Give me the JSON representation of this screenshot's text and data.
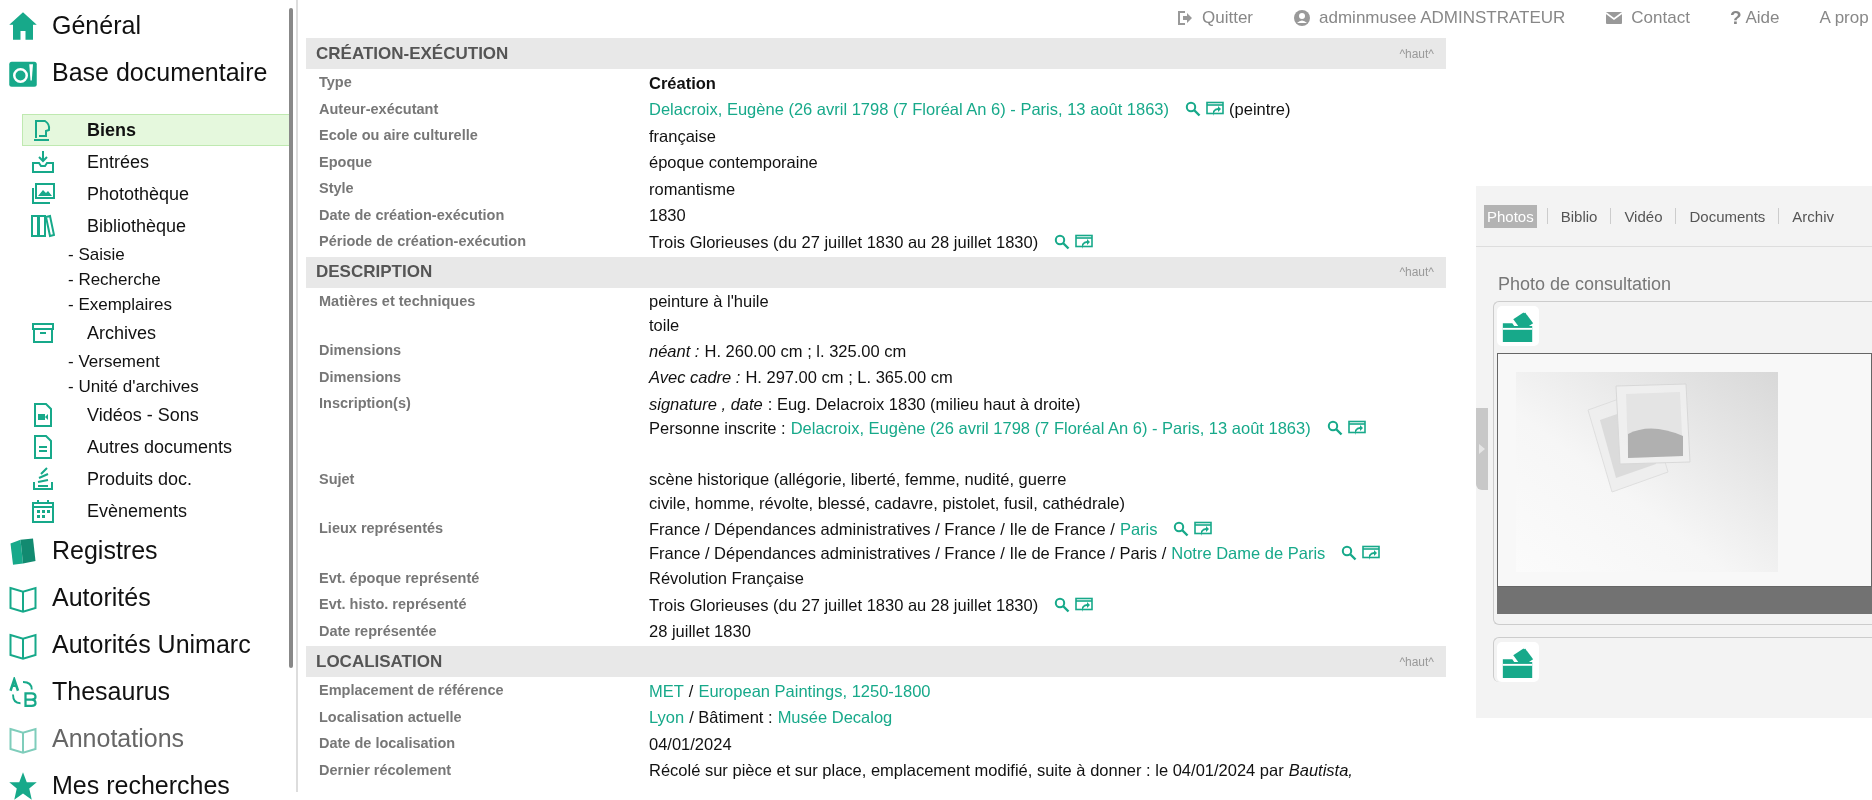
{
  "sidebar": {
    "items": [
      {
        "label": "Général",
        "disabled": false
      },
      {
        "label": "Base documentaire",
        "disabled": false,
        "children": [
          {
            "label": "Biens",
            "selected": true
          },
          {
            "label": "Entrées",
            "selected": false
          },
          {
            "label": "Photothèque",
            "selected": false
          },
          {
            "label": "Bibliothèque",
            "selected": false,
            "children": [
              {
                "label": "- Saisie"
              },
              {
                "label": "- Recherche"
              },
              {
                "label": "- Exemplaires"
              }
            ]
          },
          {
            "label": "Archives",
            "selected": false,
            "children": [
              {
                "label": "- Versement"
              },
              {
                "label": "- Unité d'archives"
              }
            ]
          },
          {
            "label": "Vidéos - Sons",
            "selected": false
          },
          {
            "label": "Autres documents",
            "selected": false
          },
          {
            "label": "Produits doc.",
            "selected": false
          },
          {
            "label": "Evènements",
            "selected": false
          }
        ]
      },
      {
        "label": "Registres",
        "disabled": false
      },
      {
        "label": "Autorités",
        "disabled": false
      },
      {
        "label": "Autorités Unimarc",
        "disabled": false
      },
      {
        "label": "Thesaurus",
        "disabled": false
      },
      {
        "label": "Annotations",
        "disabled": true
      },
      {
        "label": "Mes recherches",
        "disabled": false
      }
    ]
  },
  "top_bar": {
    "links": [
      {
        "label": "Quitter"
      },
      {
        "label": "adminmusee ADMINSTRATEUR"
      },
      {
        "label": "Contact"
      },
      {
        "label": "Aide",
        "glyph": "?"
      },
      {
        "label": "A prop"
      }
    ]
  },
  "sections": [
    {
      "title": "CRÉATION-EXÉCUTION",
      "top_link": "^haut^",
      "rows": [
        {
          "label": "Type",
          "lines": [
            [
              {
                "kind": "bold",
                "text": "Création"
              }
            ]
          ]
        },
        {
          "label": "Auteur-exécutant",
          "lines": [
            [
              {
                "kind": "link",
                "text": "Delacroix, Eugène (26 avril 1798 (7 Floréal An 6) - Paris, 13 août 1863)"
              },
              {
                "kind": "tools"
              },
              {
                "kind": "text",
                "text": "(peintre)"
              }
            ]
          ]
        },
        {
          "label": "Ecole ou aire culturelle",
          "lines": [
            [
              {
                "kind": "text",
                "text": "française"
              }
            ]
          ]
        },
        {
          "label": "Epoque",
          "lines": [
            [
              {
                "kind": "text",
                "text": "époque contemporaine"
              }
            ]
          ]
        },
        {
          "label": "Style",
          "lines": [
            [
              {
                "kind": "text",
                "text": "romantisme"
              }
            ]
          ]
        },
        {
          "label": "Date de création-exécution",
          "lines": [
            [
              {
                "kind": "text",
                "text": "1830"
              }
            ]
          ]
        },
        {
          "label": "Période de création-exécution",
          "lines": [
            [
              {
                "kind": "text",
                "text": "Trois Glorieuses (du 27 juillet 1830 au 28 juillet 1830)"
              },
              {
                "kind": "tools"
              }
            ]
          ]
        }
      ]
    },
    {
      "title": "DESCRIPTION",
      "top_link": "^haut^",
      "rows": [
        {
          "label": "Matières et techniques",
          "lines": [
            [
              {
                "kind": "text",
                "text": "peinture à l'huile"
              }
            ],
            [
              {
                "kind": "text",
                "text": "toile"
              }
            ]
          ]
        },
        {
          "label": "Dimensions",
          "lines": [
            [
              {
                "kind": "italic",
                "text": "néant :"
              },
              {
                "kind": "text",
                "text": "H. 260.00 cm ;  l. 325.00 cm"
              }
            ]
          ]
        },
        {
          "label": "Dimensions",
          "lines": [
            [
              {
                "kind": "italic",
                "text": "Avec cadre :"
              },
              {
                "kind": "text",
                "text": "H. 297.00 cm ;  L. 365.00 cm"
              }
            ]
          ]
        },
        {
          "label": "Inscription(s)",
          "space_after": true,
          "lines": [
            [
              {
                "kind": "italic",
                "text": "signature , date"
              },
              {
                "kind": "text",
                "text": ": Eug. Delacroix 1830 (milieu haut à droite)"
              }
            ],
            [
              {
                "kind": "text",
                "text": "Personne inscrite :"
              },
              {
                "kind": "link",
                "text": "Delacroix, Eugène (26 avril 1798 (7 Floréal An 6) - Paris, 13 août 1863)"
              },
              {
                "kind": "tools"
              }
            ]
          ]
        },
        {
          "label": "Sujet",
          "lines": [
            [
              {
                "kind": "text",
                "text": "scène historique (allégorie, liberté, femme, nudité, guerre"
              }
            ],
            [
              {
                "kind": "text",
                "text": "civile, homme, révolte, blessé, cadavre, pistolet, fusil, cathédrale)"
              }
            ]
          ]
        },
        {
          "label": "Lieux représentés",
          "lines": [
            [
              {
                "kind": "text",
                "text": "France / Dépendances administratives / France / Ile de France /"
              },
              {
                "kind": "link",
                "text": "Paris"
              },
              {
                "kind": "tools"
              }
            ],
            [
              {
                "kind": "text",
                "text": "France / Dépendances administratives / France / Ile de France / Paris /"
              },
              {
                "kind": "link",
                "text": "Notre Dame de Paris"
              },
              {
                "kind": "tools"
              }
            ]
          ]
        },
        {
          "label": "Evt. époque représenté",
          "lines": [
            [
              {
                "kind": "text",
                "text": "Révolution Française"
              }
            ]
          ]
        },
        {
          "label": "Evt. histo. représenté",
          "lines": [
            [
              {
                "kind": "text",
                "text": "Trois Glorieuses (du 27 juillet 1830 au 28 juillet 1830)"
              },
              {
                "kind": "tools"
              }
            ]
          ]
        },
        {
          "label": "Date représentée",
          "lines": [
            [
              {
                "kind": "text",
                "text": "28 juillet 1830"
              }
            ]
          ]
        }
      ]
    },
    {
      "title": "LOCALISATION",
      "top_link": "^haut^",
      "rows": [
        {
          "label": "Emplacement de référence",
          "lines": [
            [
              {
                "kind": "link",
                "text": "MET"
              },
              {
                "kind": "text",
                "text": "/"
              },
              {
                "kind": "link",
                "text": "European Paintings, 1250-1800"
              }
            ]
          ]
        },
        {
          "label": "Localisation actuelle",
          "lines": [
            [
              {
                "kind": "link",
                "text": "Lyon"
              },
              {
                "kind": "text",
                "text": "/  Bâtiment :"
              },
              {
                "kind": "link",
                "text": "Musée Decalog"
              }
            ]
          ]
        },
        {
          "label": "Date de localisation",
          "lines": [
            [
              {
                "kind": "text",
                "text": "04/01/2024"
              }
            ]
          ]
        },
        {
          "label": "Dernier récolement",
          "lines": [
            [
              {
                "kind": "text",
                "text": "Récolé sur pièce et sur place, emplacement modifié, suite à donner : le 04/01/2024 par"
              },
              {
                "kind": "italic",
                "text": "Bautista,"
              }
            ]
          ]
        }
      ]
    }
  ],
  "media_panel": {
    "tabs": [
      {
        "label": "Photos",
        "selected": true
      },
      {
        "label": "Biblio",
        "selected": false
      },
      {
        "label": "Vidéo",
        "selected": false
      },
      {
        "label": "Documents",
        "selected": false
      },
      {
        "label": "Archiv",
        "selected": false
      }
    ],
    "heading": "Photo de consultation",
    "cards": [
      {
        "kind": "viewer"
      },
      {
        "kind": "folder"
      }
    ]
  }
}
